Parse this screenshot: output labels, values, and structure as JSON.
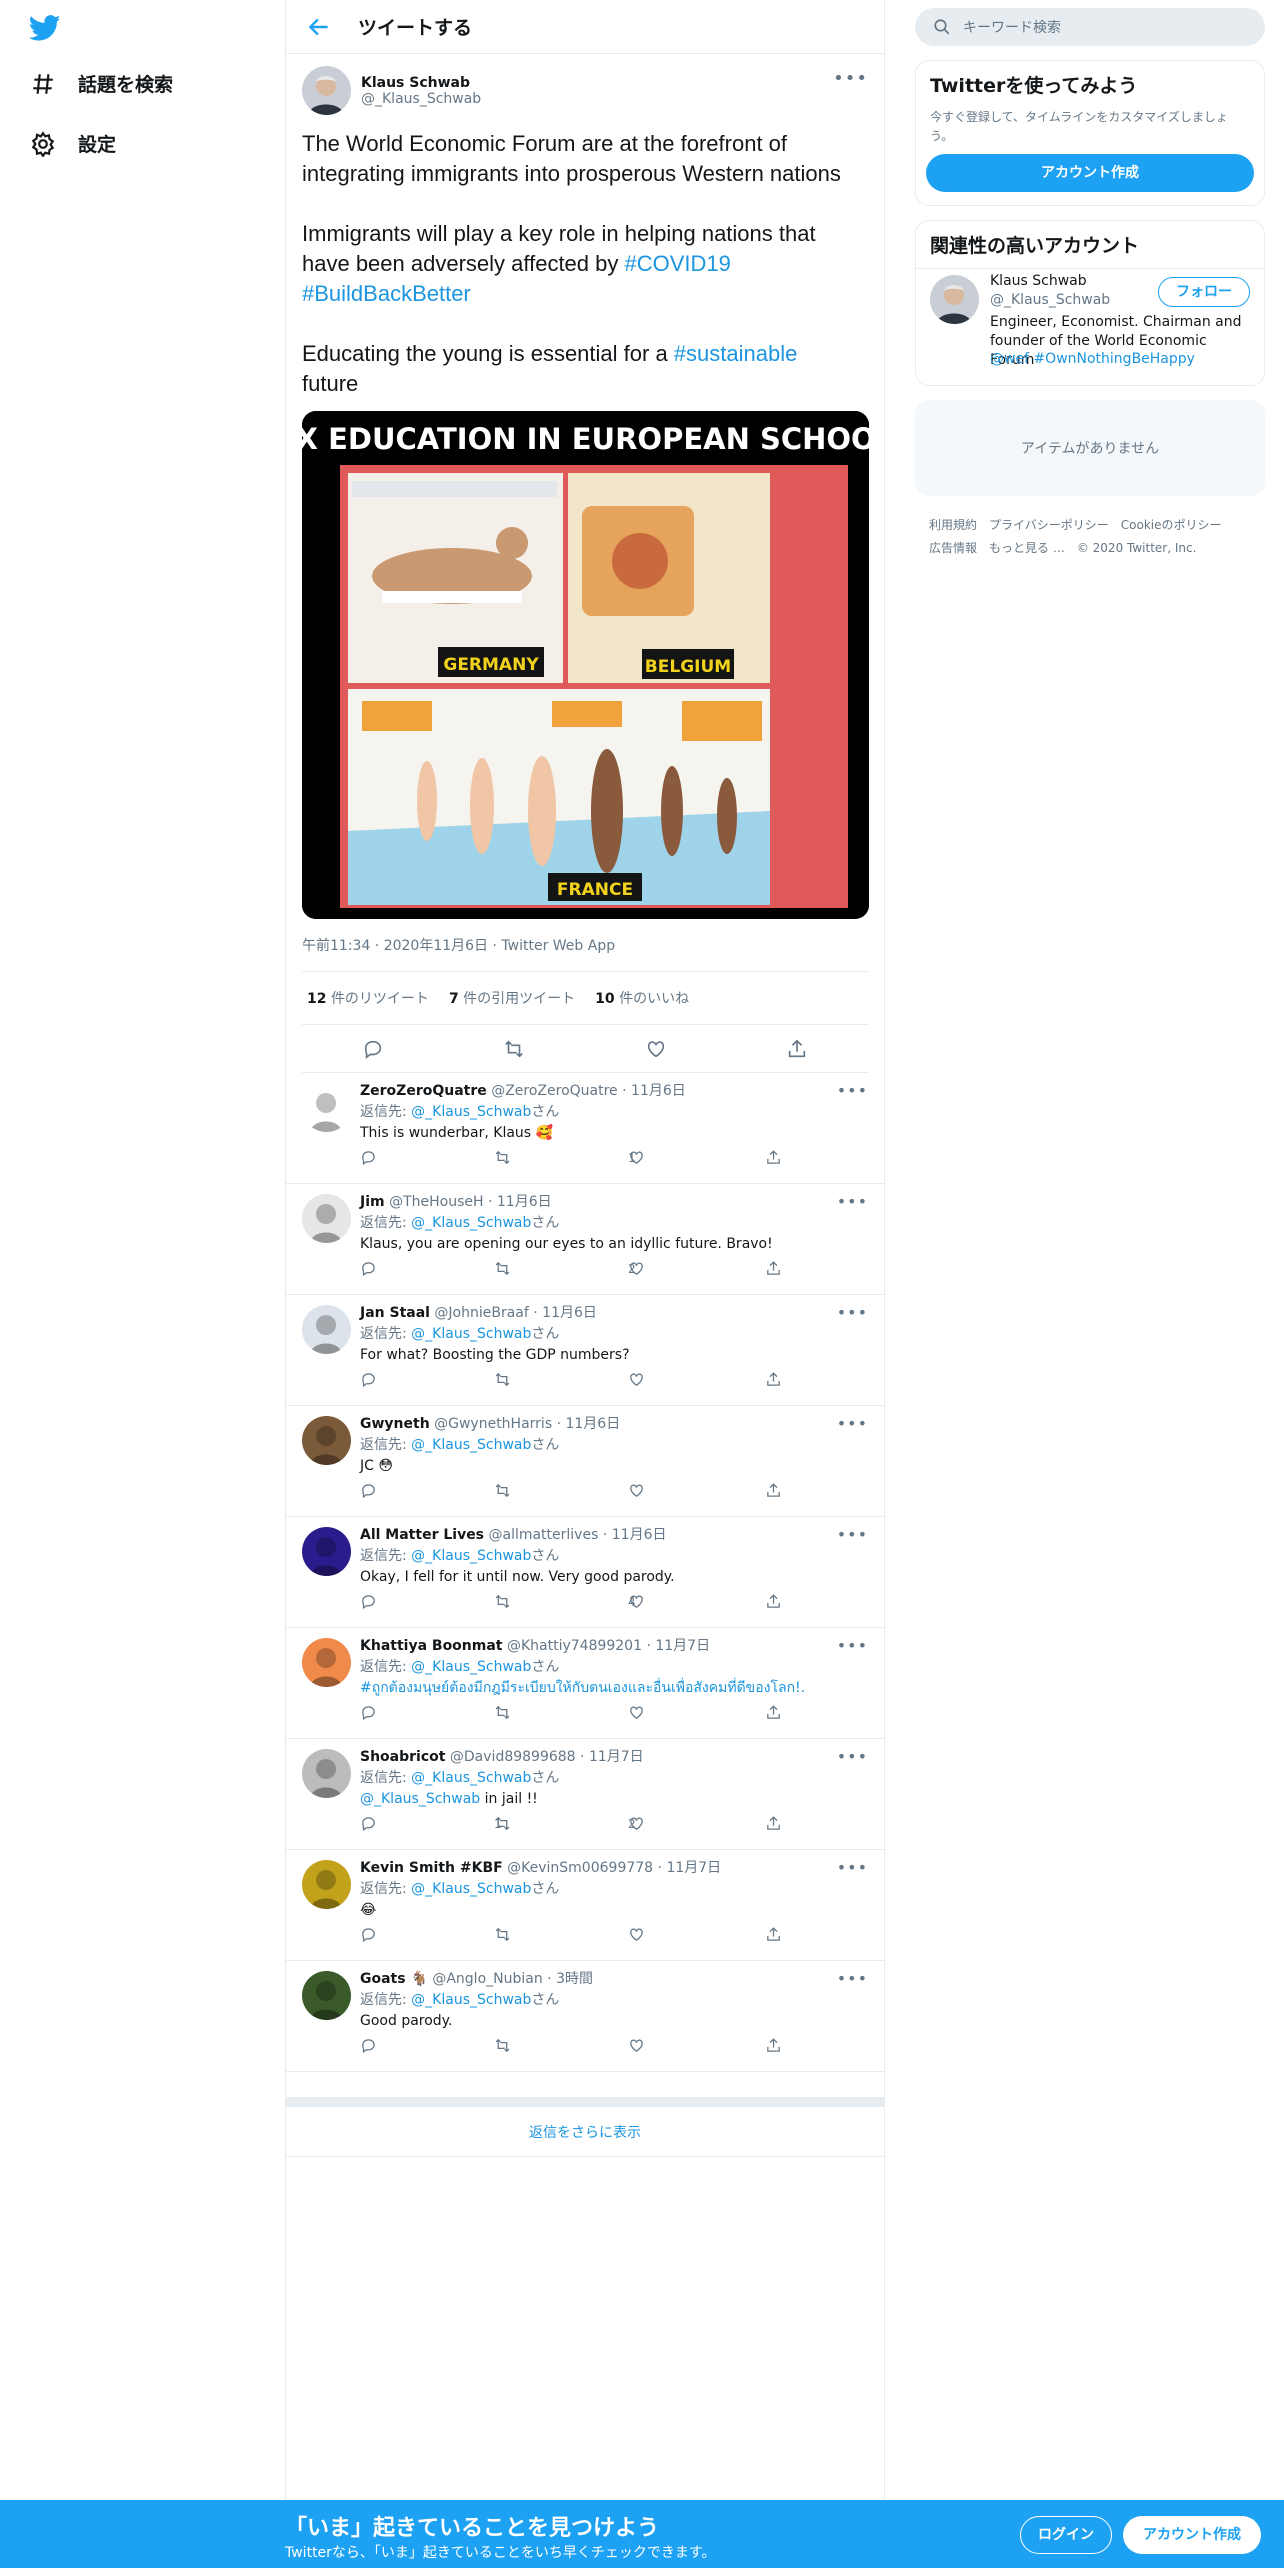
{
  "nav": {
    "explore": "話題を検索",
    "settings": "設定"
  },
  "header": {
    "title": "ツイートする"
  },
  "tweet": {
    "name": "Klaus Schwab",
    "handle": "@_Klaus_Schwab",
    "p1": "The World Economic Forum are at the forefront of integrating immigrants into prosperous Western nations",
    "p2a": "Immigrants will play a key role in helping nations that have been adversely affected by ",
    "p2tag1": "#COVID19",
    "p2tag2": "#BuildBackBetter",
    "p3a": "Educating the young is essential for a ",
    "p3tag": "#sustainable",
    "p3b": "future",
    "media": {
      "title": "SEX EDUCATION IN EUROPEAN SCHOOLS",
      "label_de": "GERMANY",
      "label_be": "BELGIUM",
      "label_fr": "FRANCE"
    },
    "meta": "午前11:34 · 2020年11月6日 · Twitter Web App",
    "rt_count": "12",
    "rt_label": "件のリツイート",
    "qt_count": "7",
    "qt_label": "件の引用ツイート",
    "like_count": "10",
    "like_label": "件のいいね"
  },
  "reply_prefix": "返信先: ",
  "reply_suffix": "さん",
  "reply_to": "@_Klaus_Schwab",
  "replies": [
    {
      "name": "ZeroZeroQuatre",
      "handle": "@ZeroZeroQuatre",
      "date": "11月6日",
      "text": "This is wunderbar, Klaus 🥰",
      "rt": "",
      "like": "1"
    },
    {
      "name": "Jim",
      "handle": "@TheHouseH",
      "date": "11月6日",
      "text": "Klaus, you are opening our eyes to an idyllic future. Bravo!",
      "rt": "",
      "like": "2"
    },
    {
      "name": "Jan Staal",
      "handle": "@JohnieBraaf",
      "date": "11月6日",
      "text": "For what? Boosting the GDP numbers?",
      "rt": "",
      "like": ""
    },
    {
      "name": "Gwyneth",
      "handle": "@GwynethHarris",
      "date": "11月6日",
      "text": "JC 😳",
      "rt": "",
      "like": ""
    },
    {
      "name": "All Matter Lives",
      "handle": "@allmatterlives",
      "date": "11月6日",
      "text": "Okay, I fell for it until now. Very good parody.",
      "rt": "",
      "like": "4"
    },
    {
      "name": "Khattiya Boonmat",
      "handle": "@Khattiy74899201",
      "date": "11月7日",
      "text": "#ถูกต้องมนุษย์ต้องมีกฎมีระเบียบให้กับตนเองและอื่นเพื่อสังคมที่ดีของโลก!.",
      "rt": "",
      "like": ""
    },
    {
      "name": "Shoabricot",
      "handle": "@David89899688",
      "date": "11月7日",
      "text": "@_Klaus_Schwab in jail !!",
      "rt": "1",
      "like": "2"
    },
    {
      "name": "Kevin Smith #KBF",
      "handle": "@KevinSm00699778",
      "date": "11月7日",
      "text": "😂",
      "rt": "",
      "like": ""
    },
    {
      "name": "Goats 🐐",
      "handle": "@Anglo_Nubian",
      "date": "3時間",
      "text": "Good parody.",
      "rt": "",
      "like": ""
    }
  ],
  "show_more": "返信をさらに表示",
  "right": {
    "search_placeholder": "キーワード検索",
    "signup_title": "Twitterを使ってみよう",
    "signup_desc": "今すぐ登録して、タイムラインをカスタマイズしましょう。",
    "signup_btn": "アカウント作成",
    "related_title": "関連性の高いアカウント",
    "rel_name": "Klaus Schwab",
    "rel_handle": "@_Klaus_Schwab",
    "follow": "フォロー",
    "rel_bio": "Engineer, Economist. Chairman and founder of the World Economic Forum",
    "rel_tags": "@wef #OwnNothingBeHappy",
    "empty": "アイテムがありません",
    "footer": [
      "利用規約",
      "プライバシーポリシー",
      "Cookieのポリシー",
      "広告情報",
      "もっと見る …",
      "© 2020 Twitter, Inc."
    ]
  },
  "banner": {
    "title": "「いま」起きていることを見つけよう",
    "sub": "Twitterなら、「いま」起きていることをいち早くチェックできます。",
    "login": "ログイン",
    "signup": "アカウント作成"
  },
  "colors": {
    "accent": "#1da1f2",
    "link": "#1b95e0",
    "muted": "#657786",
    "border": "#e6ecf0"
  }
}
